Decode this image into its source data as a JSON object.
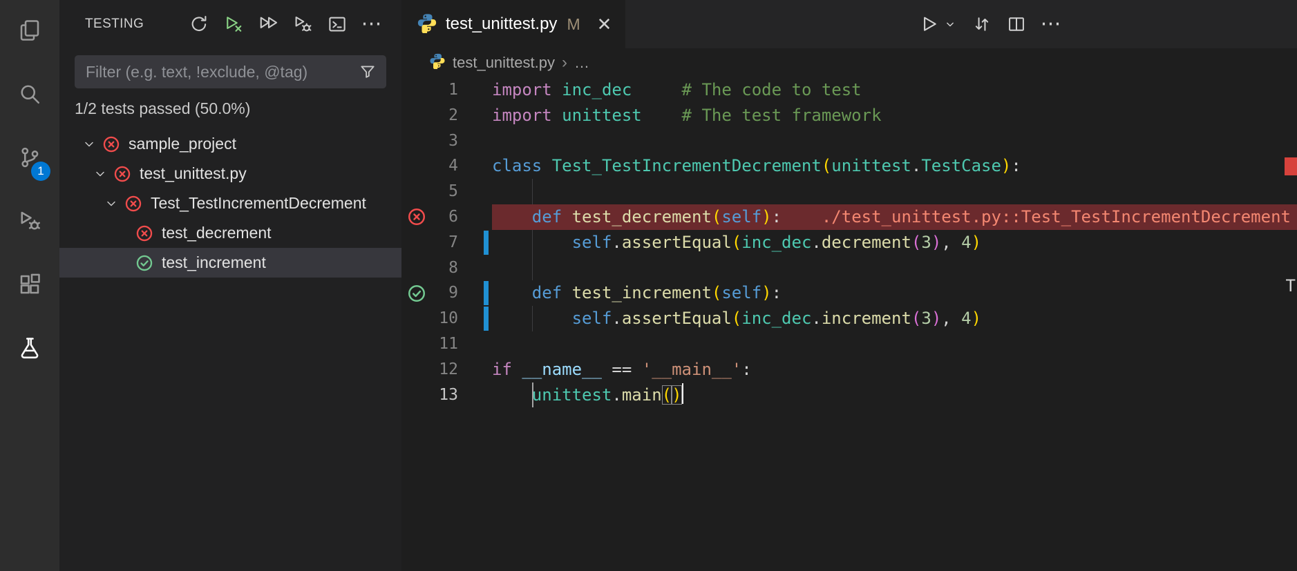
{
  "icons": {
    "close": "✕",
    "more": "⋯"
  },
  "colors": {
    "badge_accent": "#0078d4",
    "fail": "#f14c4c",
    "pass": "#73c991",
    "git_modified": "#2090d3",
    "error_line_bg": "#6b2a2d",
    "run_green": "#89d185"
  },
  "activity_bar": {
    "items": [
      {
        "name": "explorer"
      },
      {
        "name": "search"
      },
      {
        "name": "source-control",
        "badge": "1"
      },
      {
        "name": "run-and-debug"
      },
      {
        "name": "extensions"
      },
      {
        "name": "testing",
        "active": true
      }
    ]
  },
  "testing_panel": {
    "title": "TESTING",
    "toolbar": [
      {
        "name": "refresh-tests"
      },
      {
        "name": "run-failed-tests",
        "color": "#89d185"
      },
      {
        "name": "run-all-tests"
      },
      {
        "name": "debug-tests"
      },
      {
        "name": "show-output"
      },
      {
        "name": "more-actions"
      }
    ],
    "filter_placeholder": "Filter (e.g. text, !exclude, @tag)",
    "status": "1/2 tests passed (50.0%)",
    "tree": [
      {
        "label": "sample_project",
        "depth": 0,
        "state": "fail",
        "expanded": true
      },
      {
        "label": "test_unittest.py",
        "depth": 1,
        "state": "fail",
        "expanded": true
      },
      {
        "label": "Test_TestIncrementDecrement",
        "depth": 2,
        "state": "fail",
        "expanded": true
      },
      {
        "label": "test_decrement",
        "depth": 3,
        "state": "fail"
      },
      {
        "label": "test_increment",
        "depth": 3,
        "state": "pass",
        "selected": true
      }
    ]
  },
  "editor": {
    "tab": {
      "title": "test_unittest.py",
      "modified_badge": "M"
    },
    "tab_actions": [
      {
        "name": "run-python-file"
      },
      {
        "name": "run-dropdown"
      },
      {
        "name": "open-changes"
      },
      {
        "name": "split-editor"
      },
      {
        "name": "more-actions"
      }
    ],
    "breadcrumb": {
      "file": "test_unittest.py",
      "separator": "›",
      "tail": "…"
    },
    "overview_marks": {
      "text": "T"
    },
    "token_colors": {
      "pln": "#d4d4d4",
      "kw": "#c586c0",
      "kw2": "#569cd6",
      "type": "#4ec9b0",
      "fn": "#dcdcaa",
      "cmt": "#6a9955",
      "str": "#ce9178",
      "num": "#b5cea8",
      "br1": "#ffd700",
      "br2": "#da70d6",
      "var": "#9cdcfe",
      "errmsg": "#f48771"
    },
    "lines": [
      {
        "n": 1,
        "tokens": [
          [
            "import",
            "kw"
          ],
          [
            " inc_dec",
            "type"
          ],
          [
            "     ",
            "pln"
          ],
          [
            "# The code to test",
            "cmt"
          ]
        ]
      },
      {
        "n": 2,
        "tokens": [
          [
            "import",
            "kw"
          ],
          [
            " unittest",
            "type"
          ],
          [
            "    ",
            "pln"
          ],
          [
            "# The test framework",
            "cmt"
          ]
        ]
      },
      {
        "n": 3,
        "tokens": []
      },
      {
        "n": 4,
        "tokens": [
          [
            "class",
            "kw2"
          ],
          [
            " Test_TestIncrementDecrement",
            "type"
          ],
          [
            "(",
            "br1"
          ],
          [
            "unittest",
            "type"
          ],
          [
            ".",
            "pln"
          ],
          [
            "TestCase",
            "type"
          ],
          [
            ")",
            "br1"
          ],
          [
            ":",
            "pln"
          ]
        ]
      },
      {
        "n": 5,
        "guides": [
          4
        ],
        "tokens": []
      },
      {
        "n": 6,
        "gutter": "fail",
        "bg": "error",
        "tokens": [
          [
            "    ",
            "pln"
          ],
          [
            "def",
            "kw2"
          ],
          [
            " test_decrement",
            "fn"
          ],
          [
            "(",
            "br1"
          ],
          [
            "self",
            "kw2"
          ],
          [
            ")",
            "br1"
          ],
          [
            ":",
            "pln"
          ],
          [
            "    ",
            "pln"
          ],
          [
            "./test_unittest.py::Test_TestIncrementDecrement",
            "errmsg"
          ]
        ]
      },
      {
        "n": 7,
        "git": true,
        "guides": [
          4
        ],
        "tokens": [
          [
            "        ",
            "pln"
          ],
          [
            "self",
            "kw2"
          ],
          [
            ".",
            "pln"
          ],
          [
            "assertEqual",
            "fn"
          ],
          [
            "(",
            "br1"
          ],
          [
            "inc_dec",
            "type"
          ],
          [
            ".",
            "pln"
          ],
          [
            "decrement",
            "fn"
          ],
          [
            "(",
            "br2"
          ],
          [
            "3",
            "num"
          ],
          [
            ")",
            "br2"
          ],
          [
            ",",
            "pln"
          ],
          [
            " 4",
            "num"
          ],
          [
            ")",
            "br1"
          ]
        ]
      },
      {
        "n": 8,
        "guides": [
          4
        ],
        "tokens": []
      },
      {
        "n": 9,
        "gutter": "pass",
        "git": true,
        "tokens": [
          [
            "    ",
            "pln"
          ],
          [
            "def",
            "kw2"
          ],
          [
            " test_increment",
            "fn"
          ],
          [
            "(",
            "br1"
          ],
          [
            "self",
            "kw2"
          ],
          [
            ")",
            "br1"
          ],
          [
            ":",
            "pln"
          ]
        ]
      },
      {
        "n": 10,
        "git": true,
        "guides": [
          4
        ],
        "tokens": [
          [
            "        ",
            "pln"
          ],
          [
            "self",
            "kw2"
          ],
          [
            ".",
            "pln"
          ],
          [
            "assertEqual",
            "fn"
          ],
          [
            "(",
            "br1"
          ],
          [
            "inc_dec",
            "type"
          ],
          [
            ".",
            "pln"
          ],
          [
            "increment",
            "fn"
          ],
          [
            "(",
            "br2"
          ],
          [
            "3",
            "num"
          ],
          [
            ")",
            "br2"
          ],
          [
            ",",
            "pln"
          ],
          [
            " 4",
            "num"
          ],
          [
            ")",
            "br1"
          ]
        ]
      },
      {
        "n": 11,
        "tokens": []
      },
      {
        "n": 12,
        "tokens": [
          [
            "if",
            "kw"
          ],
          [
            " ",
            "pln"
          ],
          [
            "__name__",
            "var"
          ],
          [
            " == ",
            "pln"
          ],
          [
            "'__main__'",
            "str"
          ],
          [
            ":",
            "pln"
          ]
        ]
      },
      {
        "n": 13,
        "active": true,
        "cursor": true,
        "guides_active": [
          4
        ],
        "tokens": [
          [
            "    ",
            "pln"
          ],
          [
            "unittest",
            "type"
          ],
          [
            ".",
            "pln"
          ],
          [
            "main",
            "fn"
          ],
          [
            "(",
            "br1",
            "m"
          ],
          [
            ")",
            "br1",
            "m"
          ]
        ]
      }
    ]
  }
}
